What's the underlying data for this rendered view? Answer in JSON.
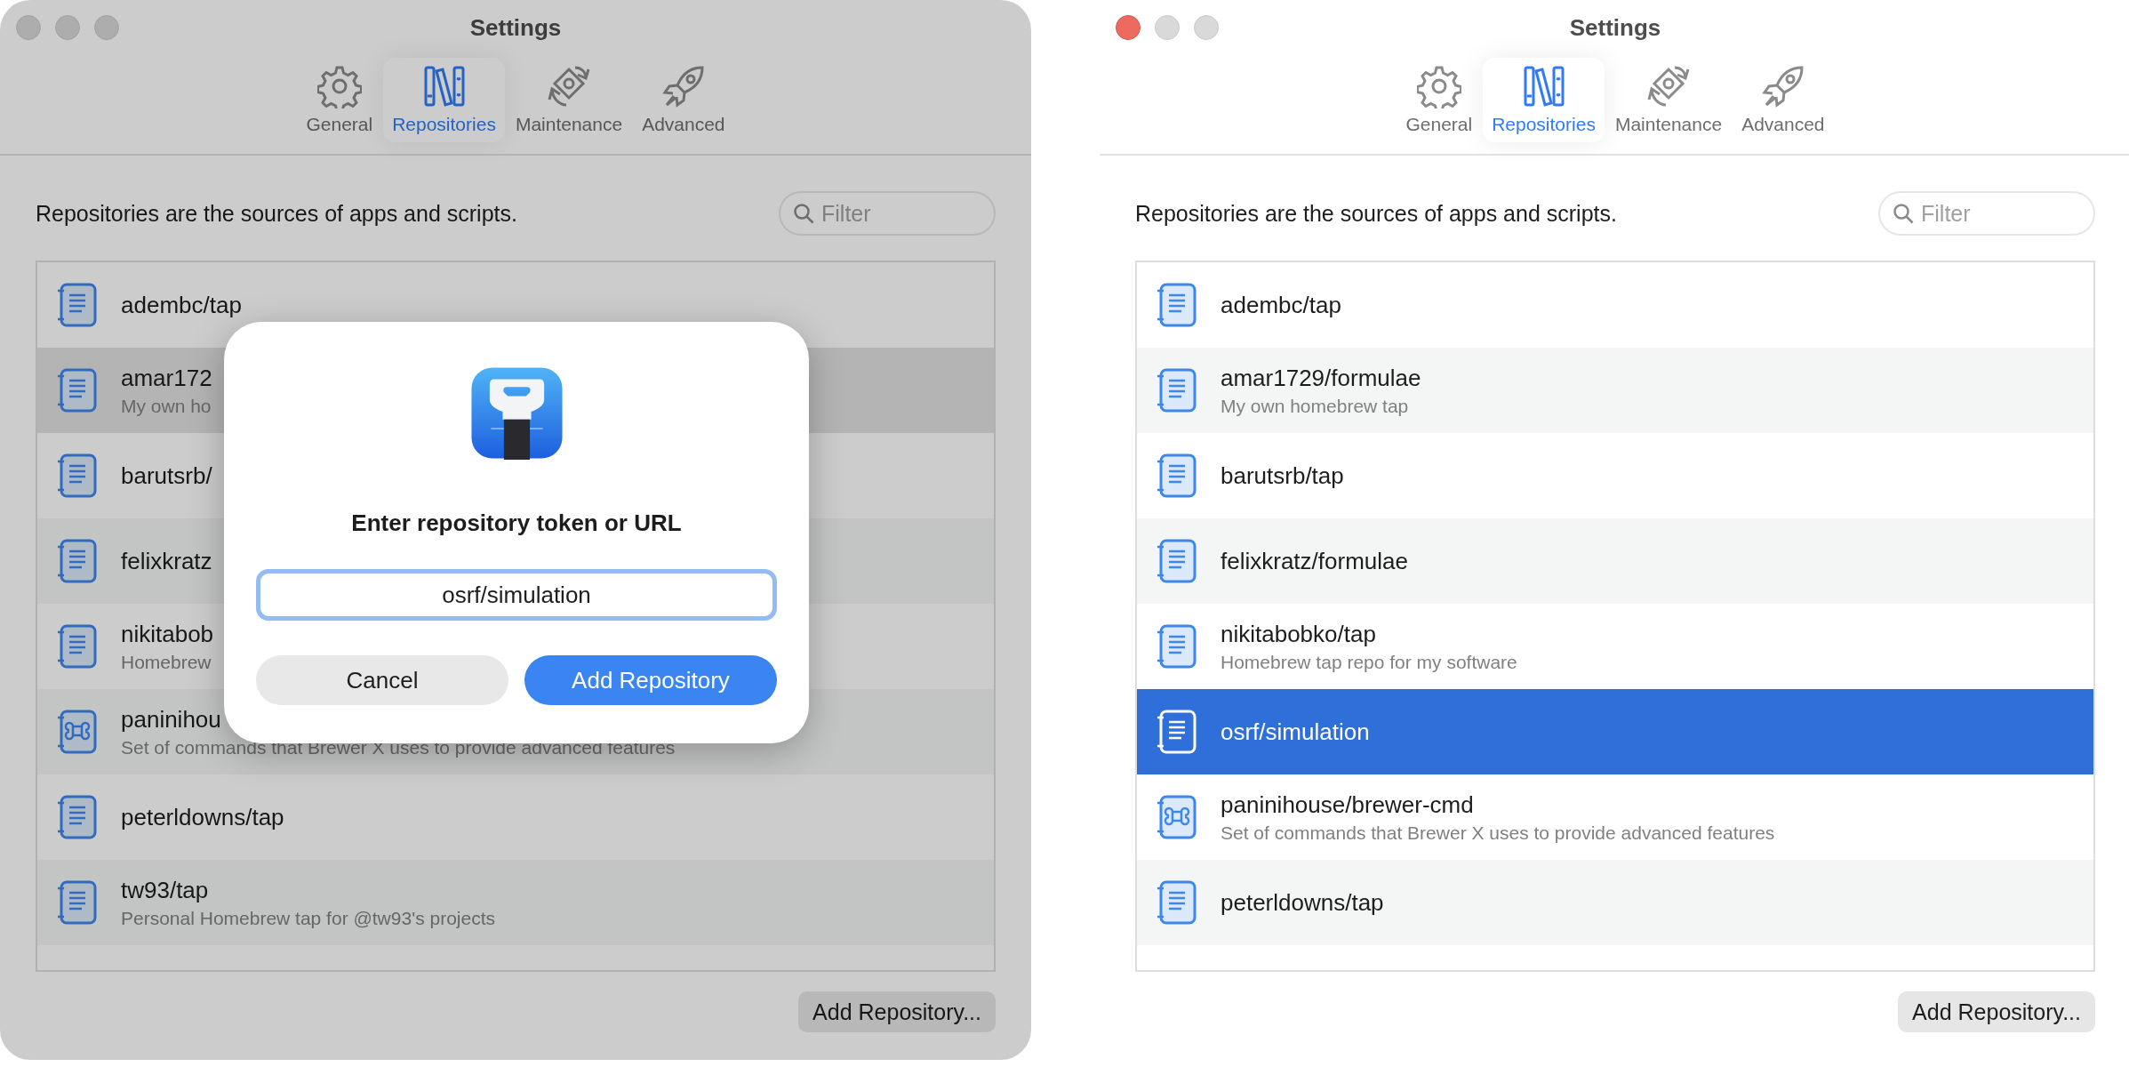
{
  "windows": [
    {
      "title": "Settings",
      "active": false,
      "dimmed": true,
      "tabs": [
        {
          "label": "General",
          "selected": false
        },
        {
          "label": "Repositories",
          "selected": true
        },
        {
          "label": "Maintenance",
          "selected": false
        },
        {
          "label": "Advanced",
          "selected": false
        }
      ],
      "description": "Repositories are the sources of apps and scripts.",
      "filter": {
        "placeholder": "Filter"
      },
      "repositories": [
        {
          "name": "adembc/tap",
          "kind": "notebook",
          "selected": false
        },
        {
          "name": "amar172",
          "subtitle": "My own ho",
          "kind": "notebook",
          "selected": true
        },
        {
          "name": "barutsrb/",
          "kind": "notebook",
          "selected": false
        },
        {
          "name": "felixkratz",
          "kind": "notebook",
          "selected": false
        },
        {
          "name": "nikitabob",
          "subtitle": "Homebrew",
          "kind": "notebook",
          "selected": false
        },
        {
          "name": "paninihou",
          "subtitle": "Set of commands that Brewer X uses to provide advanced features",
          "kind": "command",
          "selected": false
        },
        {
          "name": "peterldowns/tap",
          "kind": "notebook",
          "selected": false
        },
        {
          "name": "tw93/tap",
          "subtitle": "Personal Homebrew tap for @tw93's projects",
          "kind": "notebook",
          "selected": false
        }
      ],
      "add_button": "Add Repository...",
      "dialog": {
        "title": "Enter repository token or URL",
        "value": "osrf/simulation",
        "buttons": [
          {
            "label": "Cancel",
            "kind": "secondary"
          },
          {
            "label": "Add Repository",
            "kind": "primary"
          }
        ]
      }
    },
    {
      "title": "Settings",
      "active": true,
      "dimmed": false,
      "tabs": [
        {
          "label": "General",
          "selected": false
        },
        {
          "label": "Repositories",
          "selected": true
        },
        {
          "label": "Maintenance",
          "selected": false
        },
        {
          "label": "Advanced",
          "selected": false
        }
      ],
      "description": "Repositories are the sources of apps and scripts.",
      "filter": {
        "placeholder": "Filter"
      },
      "repositories": [
        {
          "name": "adembc/tap",
          "kind": "notebook",
          "selected": false
        },
        {
          "name": "amar1729/formulae",
          "subtitle": "My own homebrew tap",
          "kind": "notebook",
          "selected": false
        },
        {
          "name": "barutsrb/tap",
          "kind": "notebook",
          "selected": false
        },
        {
          "name": "felixkratz/formulae",
          "kind": "notebook",
          "selected": false
        },
        {
          "name": "nikitabobko/tap",
          "subtitle": "Homebrew tap repo for my software",
          "kind": "notebook",
          "selected": false
        },
        {
          "name": "osrf/simulation",
          "kind": "notebook",
          "selected": true
        },
        {
          "name": "paninihouse/brewer-cmd",
          "subtitle": "Set of commands that Brewer X uses to provide advanced features",
          "kind": "command",
          "selected": false
        },
        {
          "name": "peterldowns/tap",
          "kind": "notebook",
          "selected": false
        }
      ],
      "add_button": "Add Repository..."
    }
  ]
}
